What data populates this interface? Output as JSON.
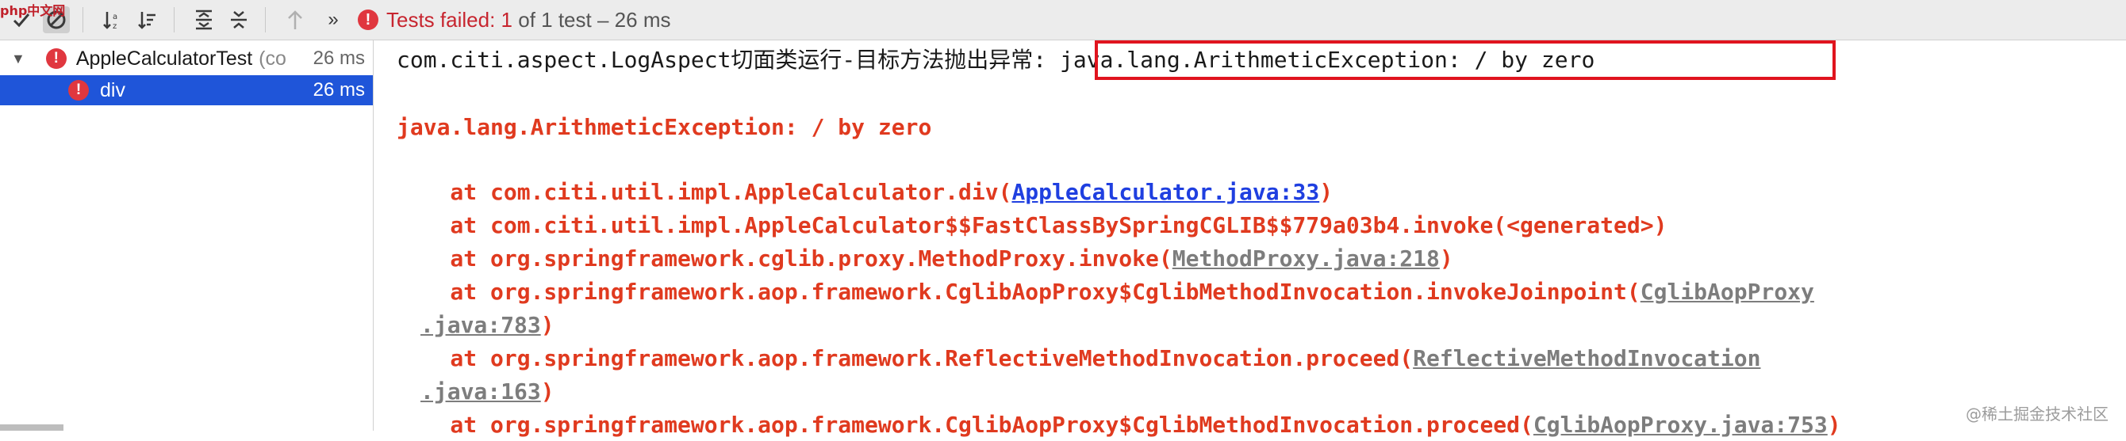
{
  "toolbar": {
    "status_label": "Tests failed:",
    "failed_count": "1",
    "of_text": "of 1 test",
    "separator": "–",
    "duration": "26 ms"
  },
  "tree": {
    "root": {
      "label": "AppleCalculatorTest",
      "hint": "(co",
      "time": "26 ms"
    },
    "child": {
      "label": "div",
      "time": "26 ms"
    }
  },
  "console": {
    "line1_prefix": "com.citi.aspect.LogAspect切面类运行-目标方法抛出",
    "line1_highlight": "异常: java.lang.ArithmeticException: / by zero",
    "exception": "java.lang.ArithmeticException: / by zero",
    "frames": [
      {
        "text": "    at com.citi.util.impl.AppleCalculator.div(",
        "link": "AppleCalculator.java:33",
        "end": ")"
      },
      {
        "text": "    at com.citi.util.impl.AppleCalculator$$FastClassBySpringCGLIB$$779a03b4.invoke(<generated>)"
      },
      {
        "text": "    at org.springframework.cglib.proxy.MethodProxy.invoke(",
        "link": "MethodProxy.java:218",
        "end": ")"
      },
      {
        "text": "    at org.springframework.aop.framework.CglibAopProxy$CglibMethodInvocation.invokeJoinpoint(",
        "link": "CglibAopProxy"
      },
      {
        "cont": ".java:783",
        "end": ")"
      },
      {
        "text": "    at org.springframework.aop.framework.ReflectiveMethodInvocation.proceed(",
        "link": "ReflectiveMethodInvocation"
      },
      {
        "cont": ".java:163",
        "end": ")"
      },
      {
        "text": "    at org.springframework.aop.framework.CglibAopProxy$CglibMethodInvocation.proceed(",
        "link": "CglibAopProxy.java:753",
        "end": ")"
      }
    ]
  },
  "watermark": "@稀土掘金技术社区",
  "logo": "php中文网"
}
